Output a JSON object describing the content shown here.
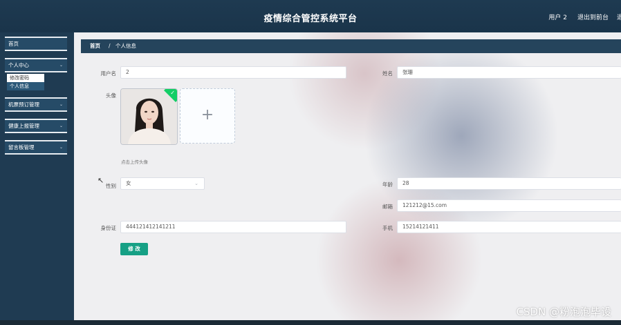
{
  "header": {
    "title": "疫情综合管控系统平台",
    "user": "用户 2",
    "back_to_front": "退出到前台",
    "cut_text": "退"
  },
  "sidebar": {
    "items": [
      {
        "label": "首页"
      },
      {
        "label": "个人中心",
        "submenu": [
          {
            "label": "修改密码"
          },
          {
            "label": "个人信息"
          }
        ]
      },
      {
        "label": "机票预订管理"
      },
      {
        "label": "健康上报管理"
      },
      {
        "label": "留言板管理"
      }
    ]
  },
  "breadcrumb": {
    "home": "首页",
    "separator": "/",
    "current": "个人信息"
  },
  "form": {
    "username_label": "用户名",
    "username_value": "2",
    "name_label": "姓名",
    "name_value": "张珊",
    "avatar_label": "头像",
    "upload_plus": "+",
    "upload_hint": "点击上传头像",
    "gender_label": "性别",
    "gender_value": "女",
    "age_label": "年龄",
    "age_value": "28",
    "email_label": "邮箱",
    "email_value": "121212@15.com",
    "idcard_label": "身份证",
    "idcard_value": "444121412141211",
    "phone_label": "手机",
    "phone_value": "15214121411",
    "submit_label": "修 改",
    "upload_success_icon": "check-icon"
  },
  "watermark": "CSDN @粉泡泡毕设",
  "colors": {
    "header_bg": "#1e3a51",
    "sidebar_bg": "#1f3b52",
    "breadcrumb_bg": "#25445c",
    "submit_bg": "#16a085"
  }
}
